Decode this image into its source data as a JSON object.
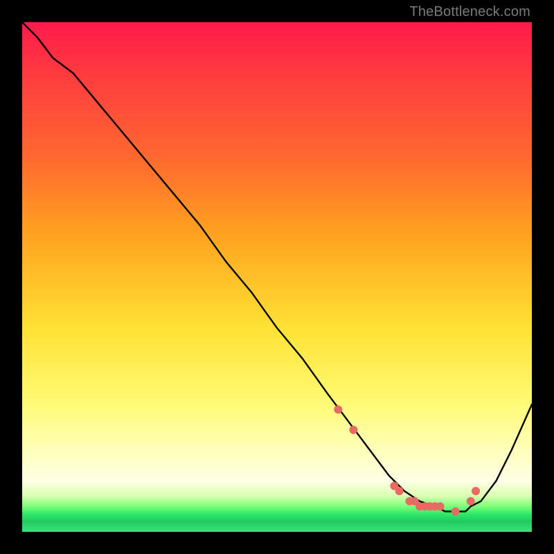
{
  "watermark": "TheBottleneck.com",
  "colors": {
    "background": "#000000",
    "curve": "#000000",
    "marker": "#e86a63",
    "gradient_top": "#ff1a4b",
    "gradient_bottom": "#39e67d"
  },
  "chart_data": {
    "type": "line",
    "title": "",
    "xlabel": "",
    "ylabel": "",
    "xlim": [
      0,
      100
    ],
    "ylim": [
      0,
      100
    ],
    "series": [
      {
        "name": "bottleneck-curve",
        "x": [
          0,
          3,
          6,
          10,
          15,
          20,
          25,
          30,
          35,
          40,
          45,
          50,
          55,
          60,
          63,
          66,
          69,
          72,
          75,
          78,
          81,
          83,
          85,
          87,
          88,
          90,
          93,
          96,
          100
        ],
        "y": [
          100,
          97,
          93,
          90,
          84,
          78,
          72,
          66,
          60,
          53,
          47,
          40,
          34,
          27,
          23,
          19,
          15,
          11,
          8,
          6,
          5,
          4,
          4,
          4,
          5,
          6,
          10,
          16,
          25
        ]
      }
    ],
    "markers": {
      "name": "highlight-dots",
      "x": [
        62,
        65,
        73,
        74,
        76,
        77,
        78,
        79,
        80,
        81,
        82,
        85,
        88,
        89
      ],
      "y": [
        24,
        20,
        9,
        8,
        6,
        6,
        5,
        5,
        5,
        5,
        5,
        4,
        6,
        8
      ]
    }
  }
}
